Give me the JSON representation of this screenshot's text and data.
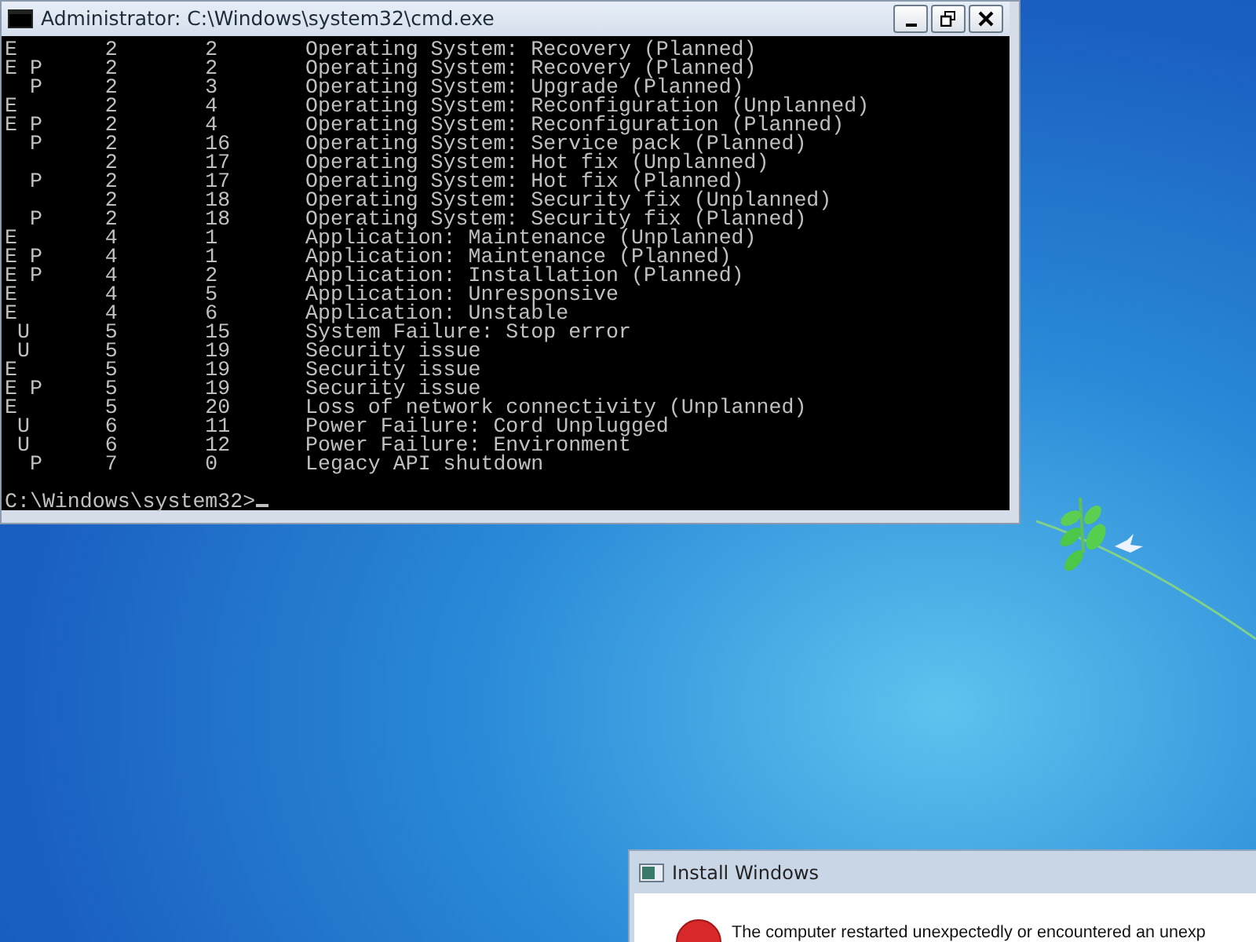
{
  "console_window": {
    "title": "Administrator: C:\\Windows\\system32\\cmd.exe",
    "lines": [
      "E       2       2       Operating System: Recovery (Planned)",
      "E P     2       2       Operating System: Recovery (Planned)",
      "  P     2       3       Operating System: Upgrade (Planned)",
      "E       2       4       Operating System: Reconfiguration (Unplanned)",
      "E P     2       4       Operating System: Reconfiguration (Planned)",
      "  P     2       16      Operating System: Service pack (Planned)",
      "        2       17      Operating System: Hot fix (Unplanned)",
      "  P     2       17      Operating System: Hot fix (Planned)",
      "        2       18      Operating System: Security fix (Unplanned)",
      "  P     2       18      Operating System: Security fix (Planned)",
      "E       4       1       Application: Maintenance (Unplanned)",
      "E P     4       1       Application: Maintenance (Planned)",
      "E P     4       2       Application: Installation (Planned)",
      "E       4       5       Application: Unresponsive",
      "E       4       6       Application: Unstable",
      " U      5       15      System Failure: Stop error",
      " U      5       19      Security issue",
      "E       5       19      Security issue",
      "E P     5       19      Security issue",
      "E       5       20      Loss of network connectivity (Unplanned)",
      " U      6       11      Power Failure: Cord Unplugged",
      " U      6       12      Power Failure: Environment",
      "  P     7       0       Legacy API shutdown"
    ],
    "prompt": "C:\\Windows\\system32>"
  },
  "dialog": {
    "title": "Install Windows",
    "message": "The computer restarted unexpectedly or encountered an unexp"
  }
}
